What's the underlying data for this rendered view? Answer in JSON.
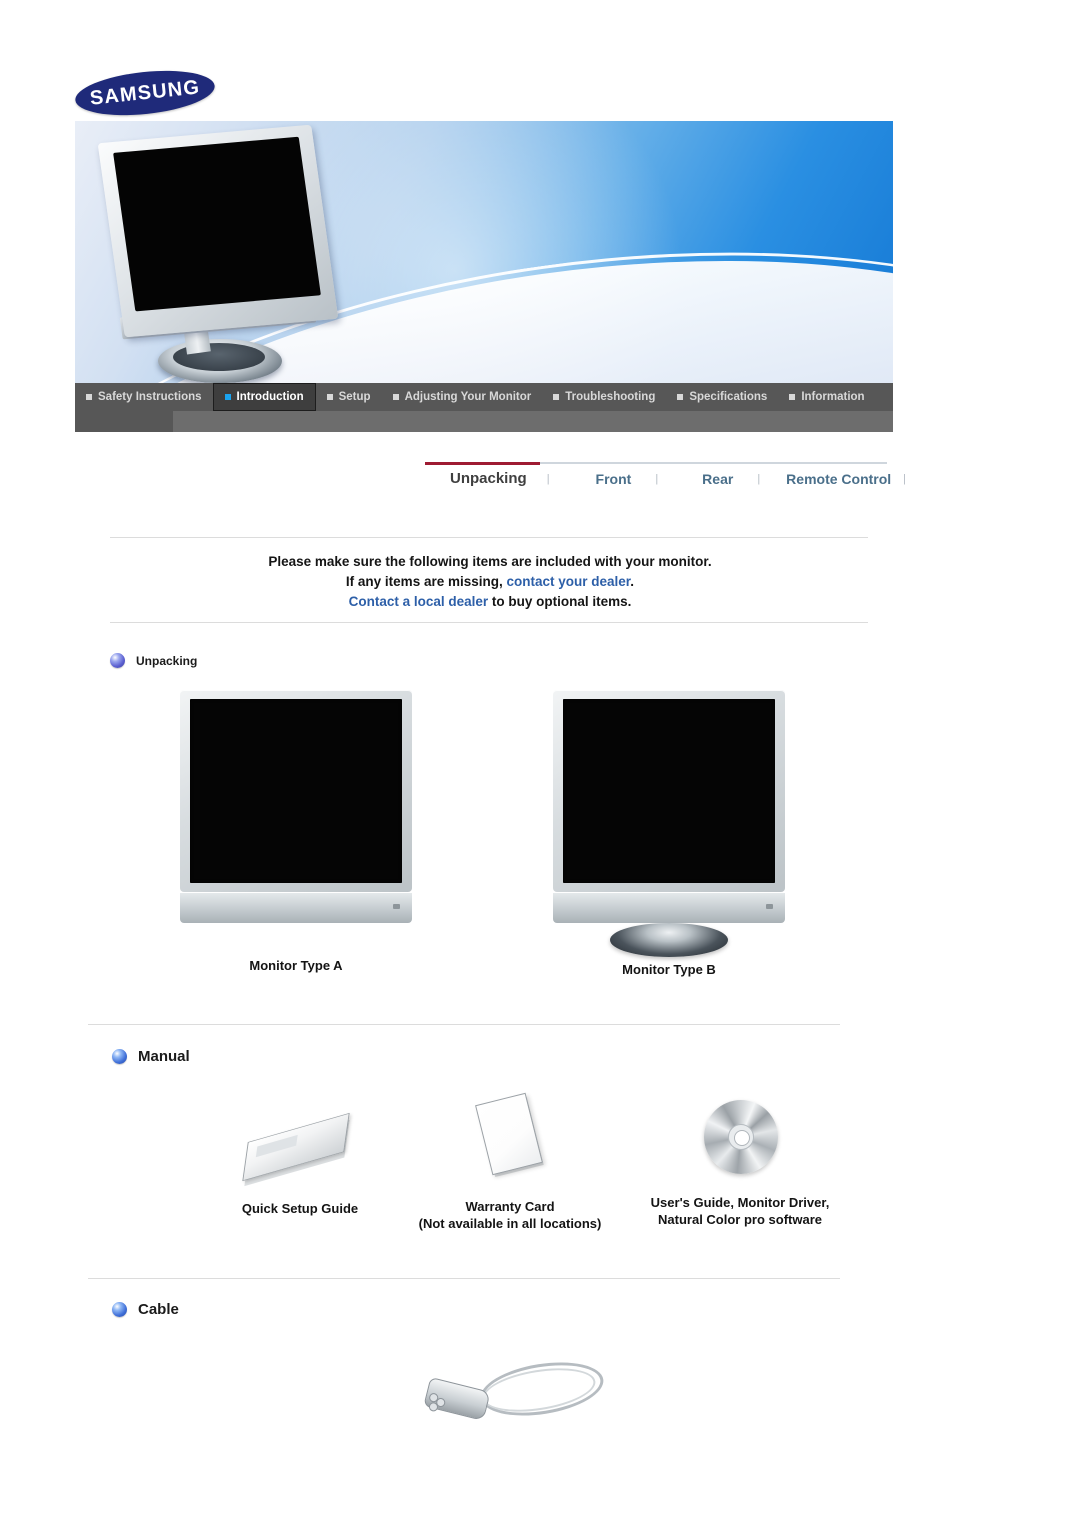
{
  "brand": {
    "name": "SAMSUNG"
  },
  "banner": {
    "product_icon": "lcd-monitor-hero-image"
  },
  "main_nav": {
    "items": [
      {
        "label": "Safety Instructions",
        "active": false
      },
      {
        "label": "Introduction",
        "active": true
      },
      {
        "label": "Setup",
        "active": false
      },
      {
        "label": "Adjusting Your Monitor",
        "active": false
      },
      {
        "label": "Troubleshooting",
        "active": false
      },
      {
        "label": "Specifications",
        "active": false
      },
      {
        "label": "Information",
        "active": false
      }
    ]
  },
  "sub_nav": {
    "accent_color": "#9e1b32",
    "link_color": "#4a6f8a",
    "separator": "|",
    "items": [
      {
        "label": "Unpacking",
        "current": true
      },
      {
        "label": "Front",
        "current": false
      },
      {
        "label": "Rear",
        "current": false
      },
      {
        "label": "Remote Control",
        "current": false
      }
    ]
  },
  "intro": {
    "line1": "Please make sure the following items are included with your monitor.",
    "line2_a": "If any items are missing, ",
    "line2_link": "contact your dealer",
    "line2_b": ".",
    "line3_link": "Contact a local dealer",
    "line3_b": " to buy optional items.",
    "link_color": "#2d5fa8"
  },
  "sections": {
    "unpacking": {
      "heading": "Unpacking",
      "items": [
        {
          "caption": "Monitor Type A",
          "icon": "lcd-monitor-type-a-image"
        },
        {
          "caption": "Monitor Type B",
          "icon": "lcd-monitor-type-b-image"
        }
      ]
    },
    "manual": {
      "heading": "Manual",
      "items": [
        {
          "caption_line1": "Quick Setup Guide",
          "caption_line2": "",
          "icon": "booklet-image"
        },
        {
          "caption_line1": "Warranty Card",
          "caption_line2": "(Not available in all locations)",
          "icon": "card-image"
        },
        {
          "caption_line1": "User's Guide, Monitor Driver,",
          "caption_line2": "Natural Color pro software",
          "icon": "cd-disc-image"
        }
      ]
    },
    "cable": {
      "heading": "Cable",
      "items": [
        {
          "caption": "",
          "icon": "power-cable-image"
        }
      ]
    }
  }
}
